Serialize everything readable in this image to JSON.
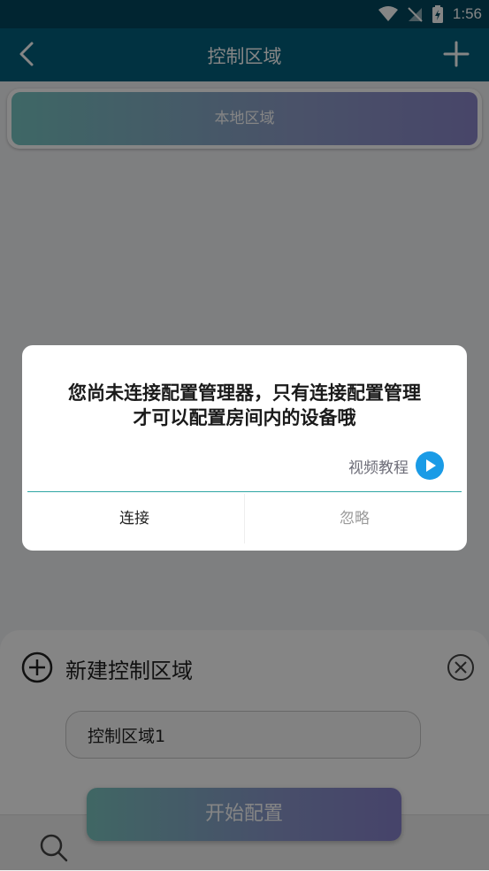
{
  "status_bar": {
    "time": "1:56"
  },
  "app_bar": {
    "title": "控制区域"
  },
  "zones": [
    {
      "label": "本地区域"
    }
  ],
  "sheet": {
    "title": "新建控制区域",
    "input_value": "控制区域1",
    "start_button": "开始配置"
  },
  "dialog": {
    "message_line1": "您尚未连接配置管理器，只有连接配置管理",
    "message_line2": "才可以配置房间内的设备哦",
    "video_link": "视频教程",
    "connect_button": "连接",
    "ignore_button": "忽略"
  },
  "colors": {
    "status_bar": "#02475e",
    "app_bar": "#03607e",
    "accent_teal": "#2fa6a4",
    "play_blue": "#1a9be6"
  },
  "icons": {
    "back": "chevron-left-icon",
    "add": "plus-icon",
    "sheet_add": "circle-plus-icon",
    "sheet_close": "circle-close-icon",
    "play": "play-icon",
    "search": "search-icon",
    "wifi": "wifi-icon",
    "signal": "signal-off-icon",
    "battery": "battery-charging-icon"
  }
}
